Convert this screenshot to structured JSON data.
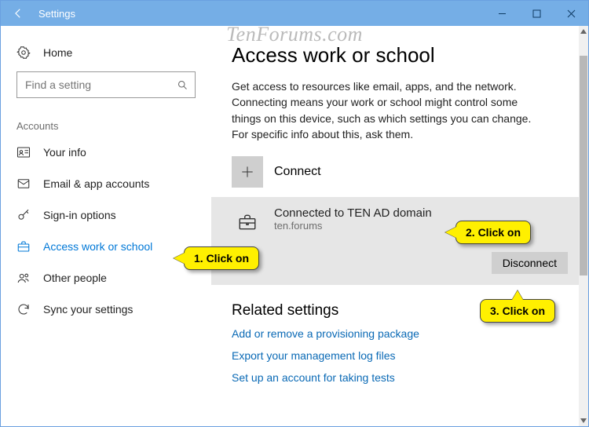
{
  "window": {
    "title": "Settings"
  },
  "watermark": "TenForums.com",
  "sidebar": {
    "home": "Home",
    "search_placeholder": "Find a setting",
    "section": "Accounts",
    "items": [
      {
        "label": "Your info"
      },
      {
        "label": "Email & app accounts"
      },
      {
        "label": "Sign-in options"
      },
      {
        "label": "Access work or school"
      },
      {
        "label": "Other people"
      },
      {
        "label": "Sync your settings"
      }
    ]
  },
  "main": {
    "heading": "Access work or school",
    "description": "Get access to resources like email, apps, and the network. Connecting means your work or school might control some things on this device, such as which settings you can change. For specific info about this, ask them.",
    "connect_label": "Connect",
    "account": {
      "title": "Connected to TEN AD domain",
      "subtitle": "ten.forums",
      "disconnect": "Disconnect"
    },
    "related_heading": "Related settings",
    "links": [
      "Add or remove a provisioning package",
      "Export your management log files",
      "Set up an account for taking tests"
    ]
  },
  "annotations": {
    "c1": "1. Click on",
    "c2": "2. Click on",
    "c3": "3. Click on"
  }
}
